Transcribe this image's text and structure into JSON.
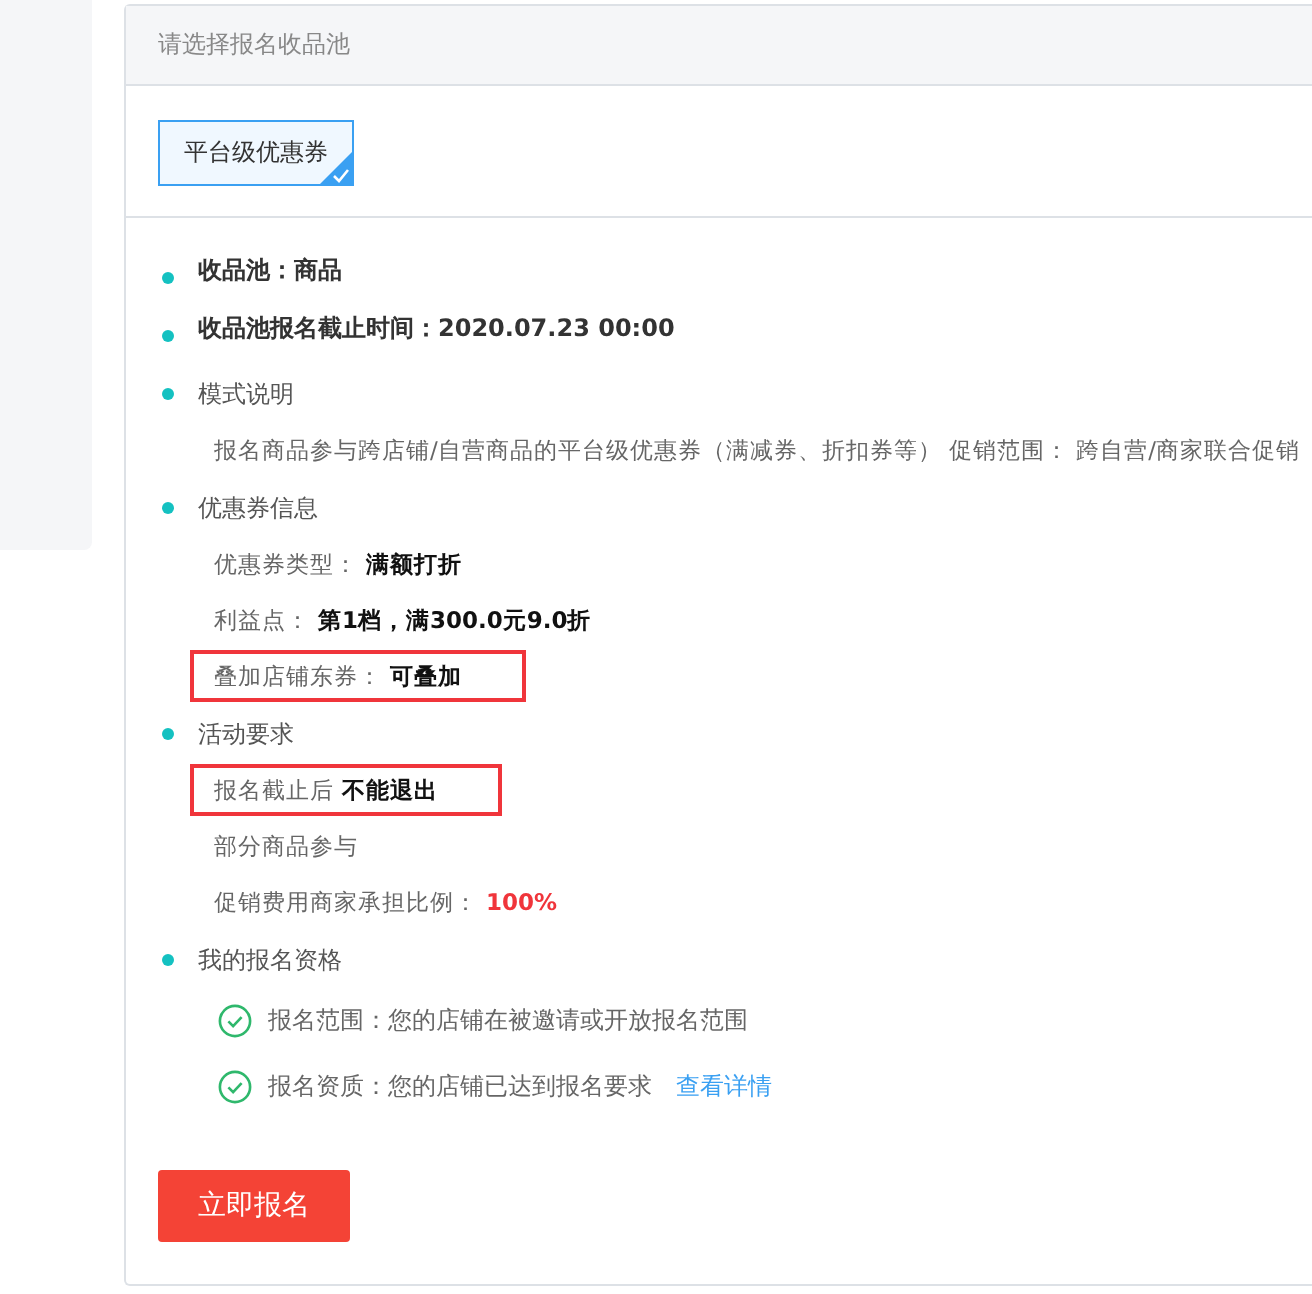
{
  "header": {
    "title": "请选择报名收品池"
  },
  "pools": [
    {
      "label": "平台级优惠券",
      "selected": true
    }
  ],
  "sections": [
    {
      "title": "收品池：商品",
      "bold": true
    },
    {
      "title": "收品池报名截止时间：2020.07.23 00:00",
      "bold": true
    },
    {
      "title": "模式说明",
      "bold": false,
      "lines": [
        {
          "label": "报名商品参与跨店铺/自营商品的平台级优惠券（满减券、折扣券等） 促销范围： 跨自营/商家联合促销",
          "highlighted": false
        }
      ]
    },
    {
      "title": "优惠券信息",
      "bold": false,
      "lines": [
        {
          "label": "优惠券类型：",
          "value": "满额打折",
          "kind": "strong",
          "highlighted": false
        },
        {
          "label": "利益点：",
          "value": "第1档，满300.0元9.0折",
          "kind": "strong",
          "highlighted": false
        },
        {
          "label": "叠加店铺东券：",
          "value": "可叠加",
          "kind": "strong",
          "highlighted": true
        }
      ]
    },
    {
      "title": "活动要求",
      "bold": false,
      "lines": [
        {
          "label": "报名截止后",
          "value": "不能退出",
          "kind": "strong",
          "highlighted": true
        },
        {
          "label": "部分商品参与",
          "highlighted": false
        },
        {
          "label": "促销费用商家承担比例：",
          "value": "100%",
          "kind": "alert",
          "highlighted": false
        }
      ]
    },
    {
      "title": "我的报名资格",
      "bold": false,
      "checks": [
        {
          "text": "报名范围：您的店铺在被邀请或开放报名范围",
          "passed": true
        },
        {
          "text": "报名资质：您的店铺已达到报名要求",
          "passed": true,
          "link": "查看详情"
        }
      ]
    }
  ],
  "submit_button": "立即报名"
}
